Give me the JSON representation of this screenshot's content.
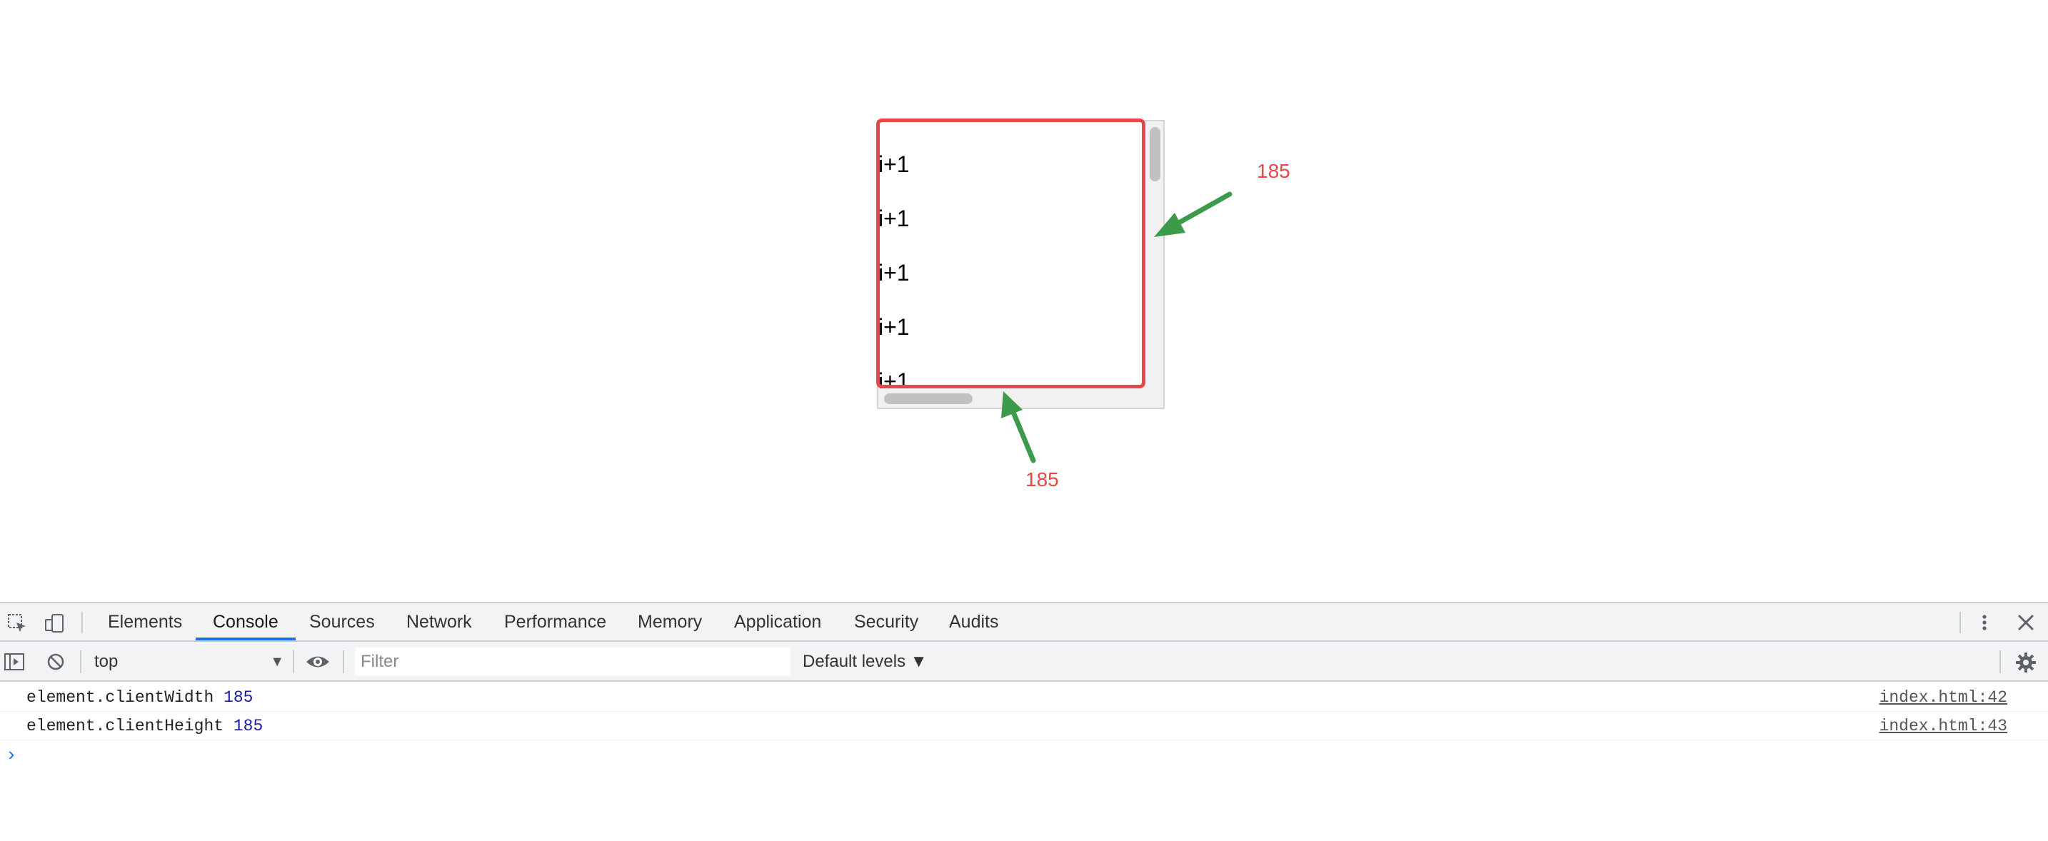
{
  "page": {
    "item_text": "i+1",
    "items": [
      "i+1",
      "i+1",
      "i+1",
      "i+1",
      "i+1"
    ],
    "annotations": {
      "width_label": "185",
      "height_label": "185",
      "highlight_color": "#e8474a",
      "arrow_color": "#3d9a4b"
    }
  },
  "devtools": {
    "tabs": [
      {
        "label": "Elements",
        "active": false
      },
      {
        "label": "Console",
        "active": true
      },
      {
        "label": "Sources",
        "active": false
      },
      {
        "label": "Network",
        "active": false
      },
      {
        "label": "Performance",
        "active": false
      },
      {
        "label": "Memory",
        "active": false
      },
      {
        "label": "Application",
        "active": false
      },
      {
        "label": "Security",
        "active": false
      },
      {
        "label": "Audits",
        "active": false
      }
    ],
    "toolbar": {
      "context": "top",
      "filter_placeholder": "Filter",
      "levels": "Default levels ▼"
    },
    "console": [
      {
        "text": "element.clientWidth",
        "value": "185",
        "source": "index.html:42"
      },
      {
        "text": "element.clientHeight",
        "value": "185",
        "source": "index.html:43"
      }
    ],
    "prompt": "›",
    "accent": "#1a73e8"
  }
}
